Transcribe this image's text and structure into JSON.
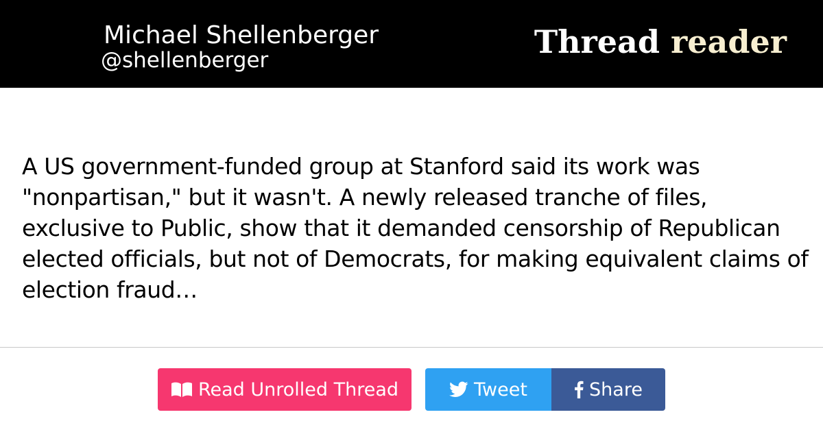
{
  "header": {
    "author_name": "Michael Shellenberger",
    "author_handle": "@shellenberger",
    "brand_word1": "Thread",
    "brand_word2": "reader"
  },
  "tweet": {
    "text": "A US government-funded group at Stanford said its work was \"nonpartisan,\" but it wasn't. A newly released tranche of files, exclusive to Public, show that it demanded censorship of Republican elected officials, but not of Democrats, for making equivalent claims of election fraud…"
  },
  "actions": {
    "read_label": "Read Unrolled Thread",
    "read_icon": "book-icon",
    "tweet_label": "Tweet",
    "tweet_icon": "twitter-bird-icon",
    "share_label": "Share",
    "share_icon": "facebook-icon"
  },
  "colors": {
    "header_bg": "#000000",
    "brand_accent": "#f7eed0",
    "read_button": "#f6376f",
    "tweet_button": "#2fa1f2",
    "share_button": "#3b5a97"
  }
}
